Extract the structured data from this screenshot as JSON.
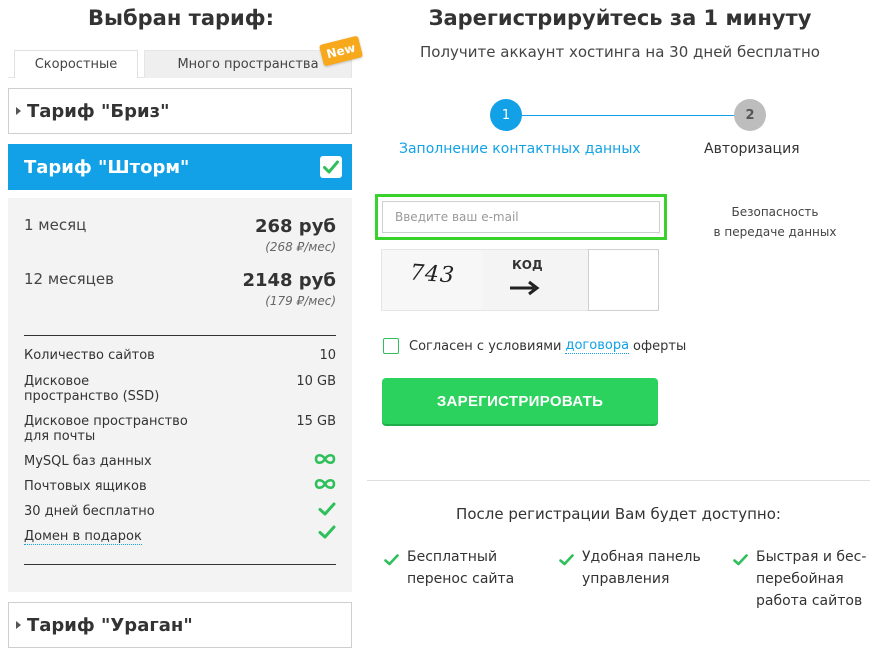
{
  "left": {
    "title": "Выбран тариф:",
    "tabs": [
      {
        "label": "Скоростные"
      },
      {
        "label": "Много пространства"
      }
    ],
    "badge": "New",
    "plans": {
      "briz": "Тариф \"Бриз\"",
      "shtorm": "Тариф \"Шторм\"",
      "uragan": "Тариф \"Ураган\""
    },
    "prices": [
      {
        "label": "1 месяц",
        "price": "268 руб",
        "per_month": "(268 ₽/мес)"
      },
      {
        "label": "12 месяцев",
        "price": "2148 руб",
        "per_month": "(179 ₽/мес)"
      }
    ],
    "features": {
      "sites": {
        "label": "Количество сайтов",
        "value": "10"
      },
      "disk": {
        "label": "Дисковое\nпространство (SSD)",
        "value": "10 GB"
      },
      "mail_disk": {
        "label": "Дисковое пространство\nдля почты",
        "value": "15 GB"
      },
      "mysql": {
        "label": "MySQL баз данных",
        "icon": "infinity-icon"
      },
      "mailboxes": {
        "label": "Почтовых ящиков",
        "icon": "infinity-icon"
      },
      "trial": {
        "label": "30 дней бесплатно",
        "icon": "check-icon"
      },
      "domain": {
        "label": "Домен в подарок",
        "icon": "check-icon"
      }
    }
  },
  "right": {
    "title": "Зарегистрируйтесь за 1 минуту",
    "subtitle": "Получите аккаунт хостинга на 30 дней бесплатно",
    "steps": [
      {
        "num": "1",
        "label": "Заполнение контактных данных"
      },
      {
        "num": "2",
        "label": "Авторизация"
      }
    ],
    "email": {
      "value": "",
      "placeholder": "Введите ваш e-mail"
    },
    "security": {
      "line1": "Безопасность",
      "line2": "в передаче данных"
    },
    "captcha": {
      "text": "743",
      "code_label": "КОД",
      "value": ""
    },
    "agree": {
      "before": "Согласен с условиями",
      "link": "договора",
      "after": "оферты"
    },
    "register_label": "ЗАРЕГИСТРИРОВАТЬ",
    "after_title": "После регистрации Вам будет доступно:",
    "benefits": [
      {
        "line1": "Бесплатный",
        "line2": "перенос сайта",
        "line3": ""
      },
      {
        "line1": "Удобная панель",
        "line2": "управления",
        "line3": ""
      },
      {
        "line1": "Быстрая и бес-",
        "line2": "перебойная",
        "line3": "работа сайтов"
      }
    ]
  },
  "colors": {
    "accent_blue": "#12a1e7",
    "green": "#2bd25d",
    "highlight_green": "#39d12c",
    "badge_orange": "#f7a81b"
  }
}
